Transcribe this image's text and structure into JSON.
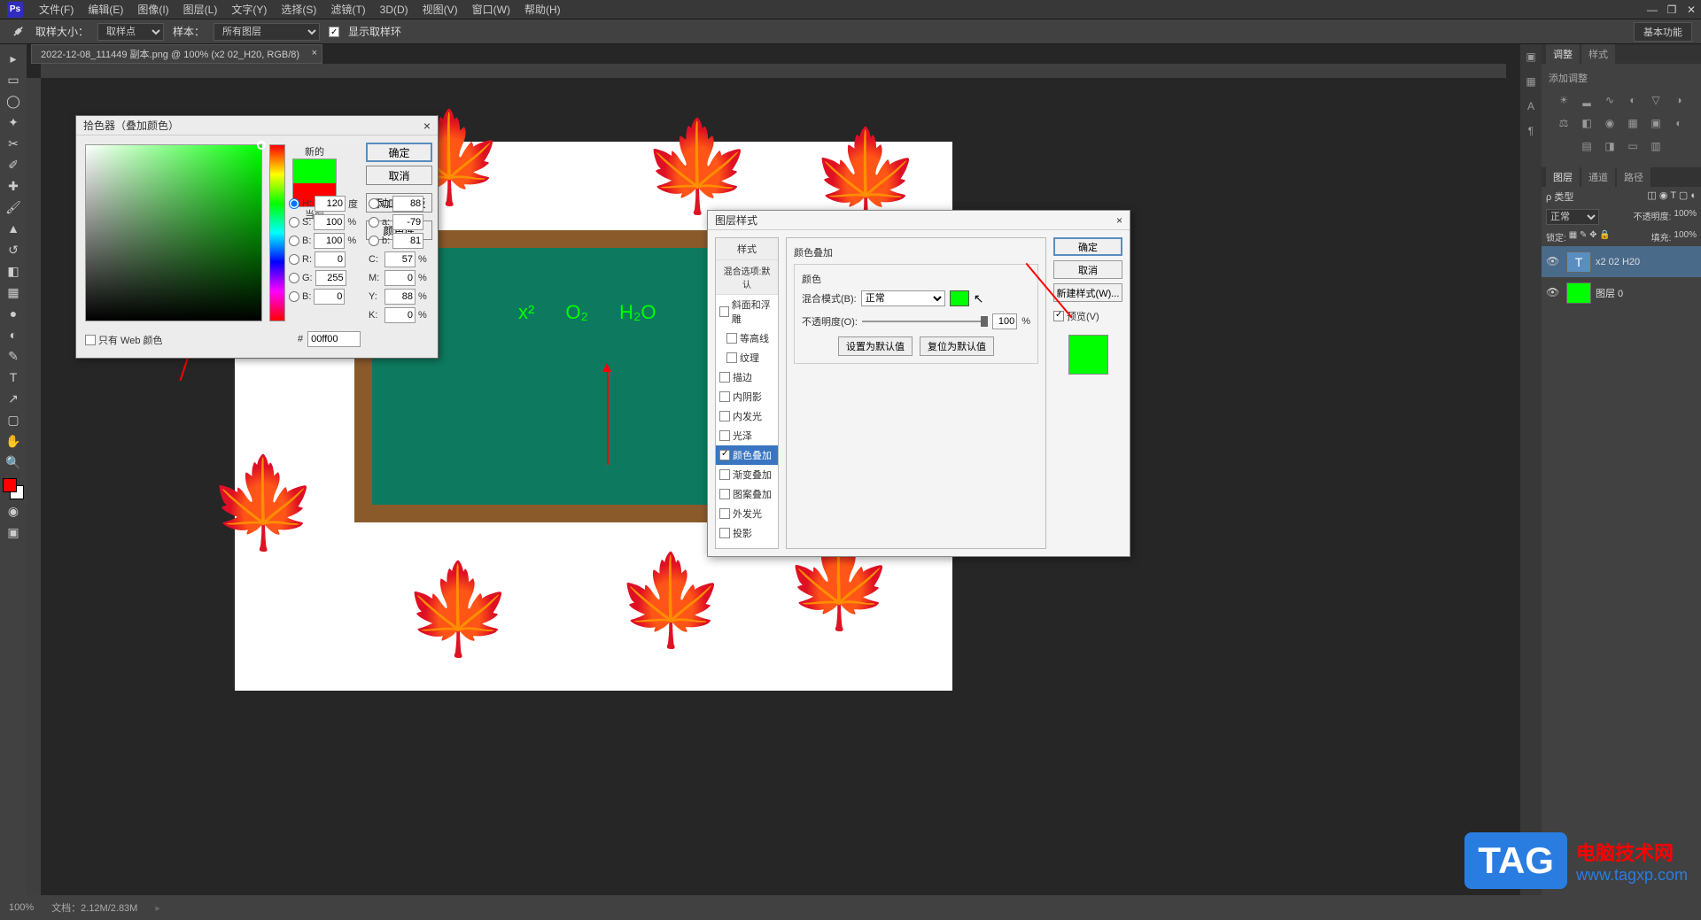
{
  "menu": {
    "items": [
      "文件(F)",
      "编辑(E)",
      "图像(I)",
      "图层(L)",
      "文字(Y)",
      "选择(S)",
      "滤镜(T)",
      "3D(D)",
      "视图(V)",
      "窗口(W)",
      "帮助(H)"
    ]
  },
  "options": {
    "sample_size_label": "取样大小：",
    "sample_size_value": "取样点",
    "sample_label": "样本：",
    "sample_value": "所有图层",
    "show_sample_ring": "显示取样环",
    "workspace_btn": "基本功能"
  },
  "document": {
    "tab": "2022-12-08_111449 副本.png @ 100% (x2  02_H20, RGB/8)",
    "formula": [
      "x²",
      "O₂",
      "H₂O"
    ]
  },
  "color_picker": {
    "title": "拾色器（叠加颜色）",
    "new_label": "新的",
    "current_label": "当前",
    "ok": "确定",
    "cancel": "取消",
    "add_swatches": "添加到色板",
    "color_lib": "颜色库",
    "web_only": "只有 Web 颜色",
    "H": "120",
    "S": "100",
    "B": "100",
    "R": "0",
    "G": "255",
    "Bv": "0",
    "L": "88",
    "a": "-79",
    "b": "81",
    "C": "57",
    "M": "0",
    "Y": "88",
    "K": "0",
    "hex": "00ff00",
    "degree": "度",
    "percent": "%"
  },
  "layer_style": {
    "title": "图层样式",
    "styles_header": "样式",
    "blend_header": "混合选项:默认",
    "items": [
      "斜面和浮雕",
      "等高线",
      "纹理",
      "描边",
      "内阴影",
      "内发光",
      "光泽",
      "颜色叠加",
      "渐变叠加",
      "图案叠加",
      "外发光",
      "投影"
    ],
    "selected_idx": 7,
    "section_title": "颜色叠加",
    "color_label": "颜色",
    "blend_mode_label": "混合模式(B):",
    "blend_mode_value": "正常",
    "opacity_label": "不透明度(O):",
    "opacity_value": "100",
    "set_default": "设置为默认值",
    "reset_default": "复位为默认值",
    "ok": "确定",
    "cancel": "取消",
    "new_style": "新建样式(W)...",
    "preview": "预览(V)"
  },
  "panels": {
    "adjust_tab": "调整",
    "style_tab": "样式",
    "add_adjust": "添加调整",
    "layers_tab": "图层",
    "channels_tab": "通道",
    "paths_tab": "路径",
    "kind_label": "ρ 类型",
    "mode": "正常",
    "opacity_label": "不透明度:",
    "opacity_value": "100%",
    "lock_label": "锁定:",
    "fill_label": "填充:",
    "fill_value": "100%",
    "layers": [
      {
        "name": "x2  02  H20",
        "type": "T",
        "selected": true
      },
      {
        "name": "图层 0",
        "type": "img",
        "selected": false
      }
    ]
  },
  "status": {
    "zoom": "100%",
    "doc_info": "文档：2.12M/2.83M"
  },
  "watermark": {
    "tag": "TAG",
    "line1": "电脑技术网",
    "line2": "www.tagxp.com"
  },
  "chart_data": null
}
